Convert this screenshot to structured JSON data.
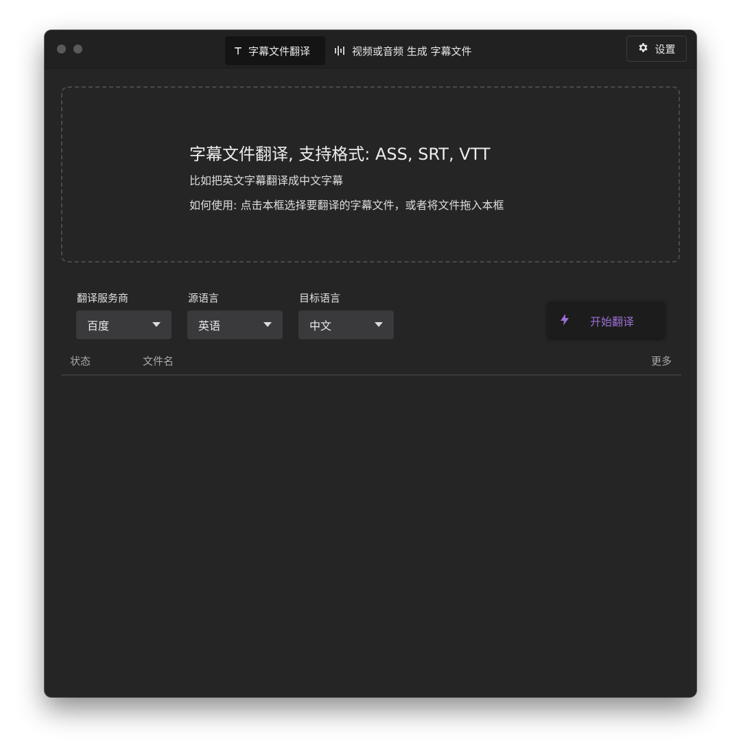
{
  "tabs": [
    {
      "label": "字幕文件翻译",
      "icon": "text-t-icon",
      "active": true
    },
    {
      "label": "视频或音频 生成 字幕文件",
      "icon": "waveform-icon",
      "active": false
    }
  ],
  "settings": {
    "label": "设置",
    "icon": "gear-icon"
  },
  "dropzone": {
    "title": "字幕文件翻译, 支持格式: ASS, SRT, VTT",
    "line1": "比如把英文字幕翻译成中文字幕",
    "line2": "如何使用: 点击本框选择要翻译的字幕文件，或者将文件拖入本框"
  },
  "provider": {
    "label": "翻译服务商",
    "value": "百度"
  },
  "source_lang": {
    "label": "源语言",
    "value": "英语"
  },
  "target_lang": {
    "label": "目标语言",
    "value": "中文"
  },
  "start_button": {
    "label": "开始翻译",
    "icon": "lightning-icon"
  },
  "table": {
    "columns": [
      "状态",
      "文件名",
      "更多"
    ],
    "rows": []
  },
  "colors": {
    "accent": "#9d6fd6",
    "background": "#252525",
    "titlebar": "#212121"
  }
}
